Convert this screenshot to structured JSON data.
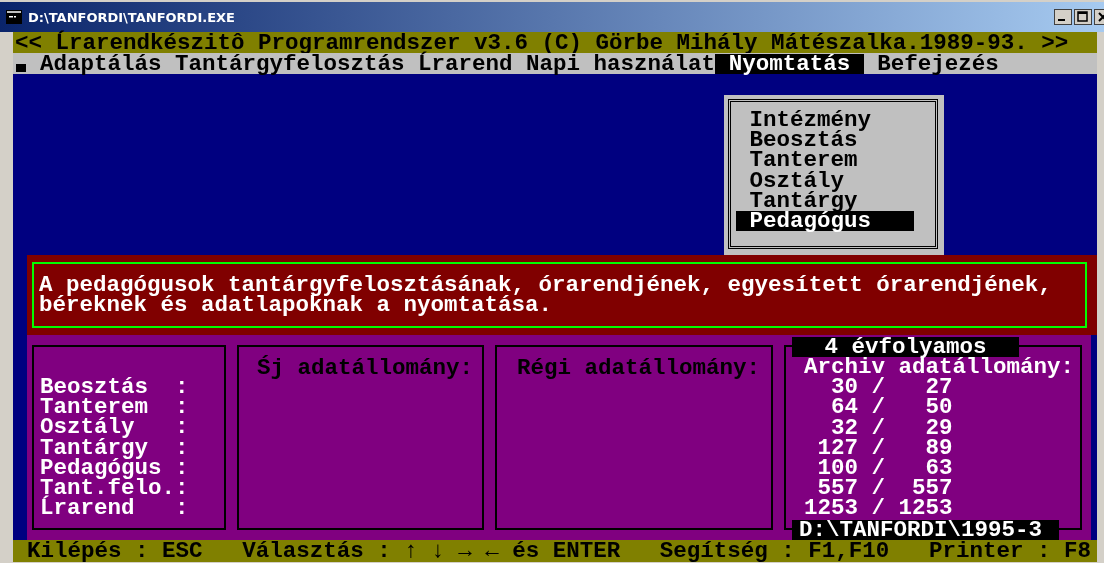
{
  "window": {
    "title": "D:\\TANFORDI\\TANFORDI.EXE"
  },
  "header": "<< Ĺrarendkészitô Programrendszer v3.6 (C) Görbe Mihály Mátészalka.1989-93. >>",
  "menu": [
    {
      "label": "Adaptálás",
      "selected": false
    },
    {
      "label": "Tantárgyfelosztás",
      "selected": false
    },
    {
      "label": "Ĺrarend",
      "selected": false
    },
    {
      "label": "Napi használat",
      "selected": false
    },
    {
      "label": "Nyomtatás",
      "selected": true
    },
    {
      "label": "Befejezés",
      "selected": false
    }
  ],
  "dropdown": [
    {
      "label": "Intézmény",
      "selected": false
    },
    {
      "label": "Beosztás",
      "selected": false
    },
    {
      "label": "Tanterem",
      "selected": false
    },
    {
      "label": "Osztály",
      "selected": false
    },
    {
      "label": "Tantárgy",
      "selected": false
    },
    {
      "label": "Pedagógus",
      "selected": true
    }
  ],
  "description": "A pedagógusok tantárgyfelosztásának, órarendjének, egyesített órarendjének, béreknek és adatlapoknak a nyomtatása.",
  "summary": {
    "labels": [
      "Beosztás  :",
      "Tanterem  :",
      "Osztály   :",
      "Tantárgy  :",
      "Pedagógus :",
      "Tant.felo.:",
      "Ĺrarend   :"
    ],
    "new_heading": "Śj adatállomány:",
    "old_heading": "Régi adatállomány:",
    "archive": {
      "title": "4 évfolyamos",
      "heading": "Archiv adatállomány:",
      "rows": [
        "  30 /   27",
        "  64 /   50",
        "  32 /   29",
        " 127 /   89",
        " 100 /   63",
        " 557 /  557",
        "1253 / 1253"
      ],
      "path": "D:\\TANFORDI\\1995-3"
    }
  },
  "status_bar": [
    "Kilépés : ESC",
    "Választás : ↑ ↓ → ← és ENTER",
    "Segítség : F1,F10",
    "Printer : F8"
  ]
}
